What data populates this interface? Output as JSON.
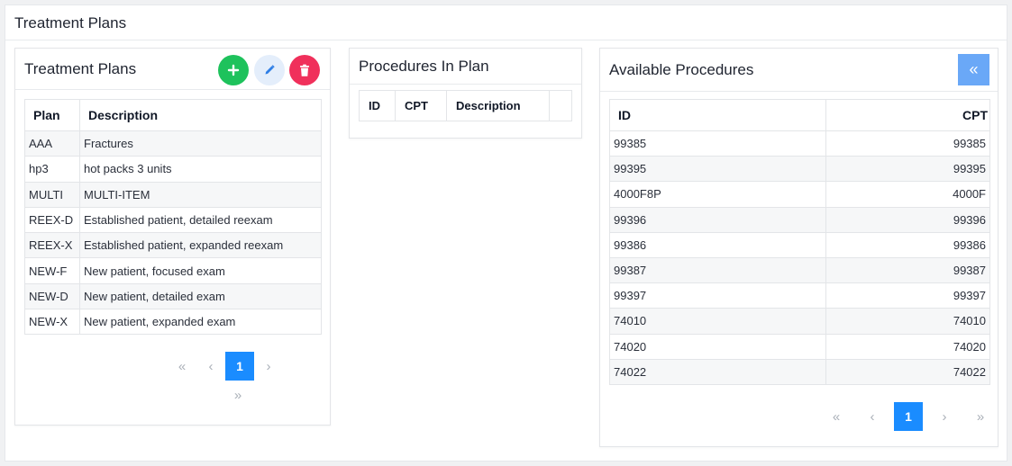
{
  "page": {
    "title": "Treatment Plans"
  },
  "plans_card": {
    "title": "Treatment Plans",
    "actions": {
      "add_icon": "plus-icon",
      "edit_icon": "pencil-icon",
      "delete_icon": "trash-icon"
    },
    "columns": [
      "Plan",
      "Description"
    ],
    "rows": [
      {
        "plan": "AAA",
        "description": "Fractures"
      },
      {
        "plan": "hp3",
        "description": "hot packs 3 units"
      },
      {
        "plan": "MULTI",
        "description": "MULTI-ITEM"
      },
      {
        "plan": "REEX-D",
        "description": "Established patient, detailed reexam"
      },
      {
        "plan": "REEX-X",
        "description": "Established patient, expanded reexam"
      },
      {
        "plan": "NEW-F",
        "description": "New patient, focused exam"
      },
      {
        "plan": "NEW-D",
        "description": "New patient, detailed exam"
      },
      {
        "plan": "NEW-X",
        "description": "New patient, expanded exam"
      }
    ],
    "pager": {
      "first": "«",
      "prev": "‹",
      "current": "1",
      "next": "›",
      "last": "»"
    }
  },
  "procedures_card": {
    "title": "Procedures In Plan",
    "columns": [
      "ID",
      "CPT",
      "Description",
      ""
    ]
  },
  "available_card": {
    "title": "Available Procedures",
    "collapse_label": "«",
    "columns": [
      "ID",
      "CPT"
    ],
    "rows": [
      {
        "id": "99385",
        "cpt": "99385"
      },
      {
        "id": "99395",
        "cpt": "99395"
      },
      {
        "id": "4000F8P",
        "cpt": "4000F"
      },
      {
        "id": "99396",
        "cpt": "99396"
      },
      {
        "id": "99386",
        "cpt": "99386"
      },
      {
        "id": "99387",
        "cpt": "99387"
      },
      {
        "id": "99397",
        "cpt": "99397"
      },
      {
        "id": "74010",
        "cpt": "74010"
      },
      {
        "id": "74020",
        "cpt": "74020"
      },
      {
        "id": "74022",
        "cpt": "74022"
      }
    ],
    "pager": {
      "first": "«",
      "prev": "‹",
      "current": "1",
      "next": "›",
      "last": "»"
    }
  },
  "colors": {
    "add": "#1ec25c",
    "edit_bg": "#e4eefb",
    "delete": "#f0305b",
    "primary": "#1a8cff",
    "collapse": "#6aa8f7"
  }
}
